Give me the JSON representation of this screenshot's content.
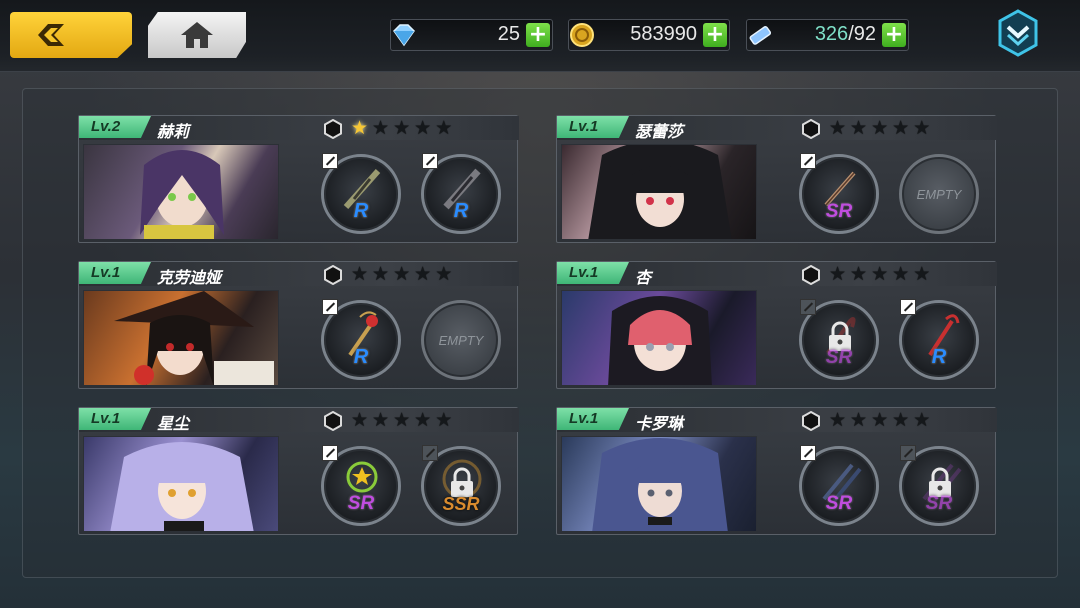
{
  "resources": {
    "gems": "25",
    "gold": "583990",
    "stamina": "326",
    "stamina_max": "/92"
  },
  "cards": [
    {
      "level": "Lv.2",
      "name": "赫莉",
      "stars_on": 1,
      "slots": [
        {
          "rank": "R",
          "state": "weapon"
        },
        {
          "rank": "R",
          "state": "weapon"
        }
      ]
    },
    {
      "level": "Lv.1",
      "name": "瑟蕾莎",
      "stars_on": 0,
      "slots": [
        {
          "rank": "SR",
          "state": "weapon"
        },
        {
          "rank": "",
          "state": "empty",
          "label": "EMPTY"
        }
      ]
    },
    {
      "level": "Lv.1",
      "name": "克劳迪娅",
      "stars_on": 0,
      "slots": [
        {
          "rank": "R",
          "state": "weapon"
        },
        {
          "rank": "",
          "state": "empty",
          "label": "EMPTY"
        }
      ]
    },
    {
      "level": "Lv.1",
      "name": "杏",
      "stars_on": 0,
      "slots": [
        {
          "rank": "SR",
          "state": "locked"
        },
        {
          "rank": "R",
          "state": "weapon"
        }
      ]
    },
    {
      "level": "Lv.1",
      "name": "星尘",
      "stars_on": 0,
      "slots": [
        {
          "rank": "SR",
          "state": "weapon"
        },
        {
          "rank": "SSR",
          "state": "locked"
        }
      ]
    },
    {
      "level": "Lv.1",
      "name": "卡罗琳",
      "stars_on": 0,
      "slots": [
        {
          "rank": "SR",
          "state": "weapon"
        },
        {
          "rank": "SR",
          "state": "locked"
        }
      ]
    }
  ],
  "empty_label": "EMPTY",
  "colors": {
    "accent": "#f5c02a",
    "level_badge": "#5ccb8e",
    "plus": "#4fbf2a",
    "r": "#2a8cff",
    "sr": "#c04ddf",
    "ssr": "#d98b2e"
  },
  "icons": [
    "back-arrow-icon",
    "home-icon",
    "gem-icon",
    "gold-coin-icon",
    "stamina-ticket-icon",
    "plus-icon",
    "menu-chevron-icon",
    "hexagon-icon",
    "star-icon",
    "lock-icon"
  ]
}
